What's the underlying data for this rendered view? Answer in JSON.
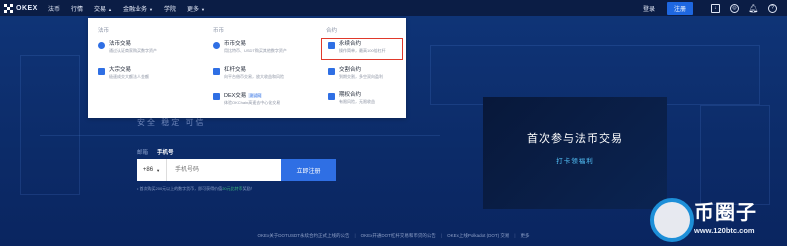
{
  "nav": {
    "logo_text": "OKEX",
    "items": [
      "法币",
      "行情",
      "交易",
      "金融业务",
      "学院",
      "更多"
    ],
    "login": "登录",
    "register": "注册",
    "icons": [
      "download-icon",
      "globe-icon",
      "bell-icon",
      "help-icon"
    ]
  },
  "dropdown": {
    "cols": [
      {
        "title": "法币",
        "entries": [
          {
            "title": "法币交易",
            "desc": "通过认证商家购买数字资产"
          },
          {
            "title": "大宗交易",
            "desc": "极速成交大额法人金额"
          }
        ]
      },
      {
        "title": "币币",
        "entries": [
          {
            "title": "币币交易",
            "desc": "用比特币、USDT购买其他数字资产"
          },
          {
            "title": "杠杆交易",
            "desc": "向平台借币交易，放大收益和风险"
          },
          {
            "title": "DEX交易",
            "tag": "测试网",
            "desc": "体验OKChain高速去中心化交易"
          }
        ]
      },
      {
        "title": "合约",
        "entries": [
          {
            "title": "永续合约",
            "desc": "操作简单，最高100倍杠杆"
          },
          {
            "title": "交割合约",
            "desc": "到期交割，多空双向盈利"
          },
          {
            "title": "期权合约",
            "desc": "有限风险，无限收益"
          }
        ]
      }
    ]
  },
  "hero": {
    "slogan": "安全 稳定 可信",
    "tab_email": "邮箱",
    "tab_phone": "手机号",
    "prefix": "+86",
    "phone_placeholder": "手机号码",
    "submit": "立即注册",
    "note_pre": "• 首次购买200元以上的数字货币，即可获得价值",
    "note_highlight": "20元比特币",
    "note_post": "奖励！"
  },
  "promo": {
    "title": "首次参与法币交易",
    "subtitle": "打卡领福利"
  },
  "announcements": {
    "items": [
      "OKEx关于DOTUSDT永续合约正式上线的公告",
      "OKEx开通DOT杠杆交易和币贷的公告",
      "OKEx上线Polkadot (DOT) 交易"
    ],
    "more": "更多"
  },
  "watermark": {
    "brand": "币圈子",
    "url": "www.120btc.com"
  }
}
